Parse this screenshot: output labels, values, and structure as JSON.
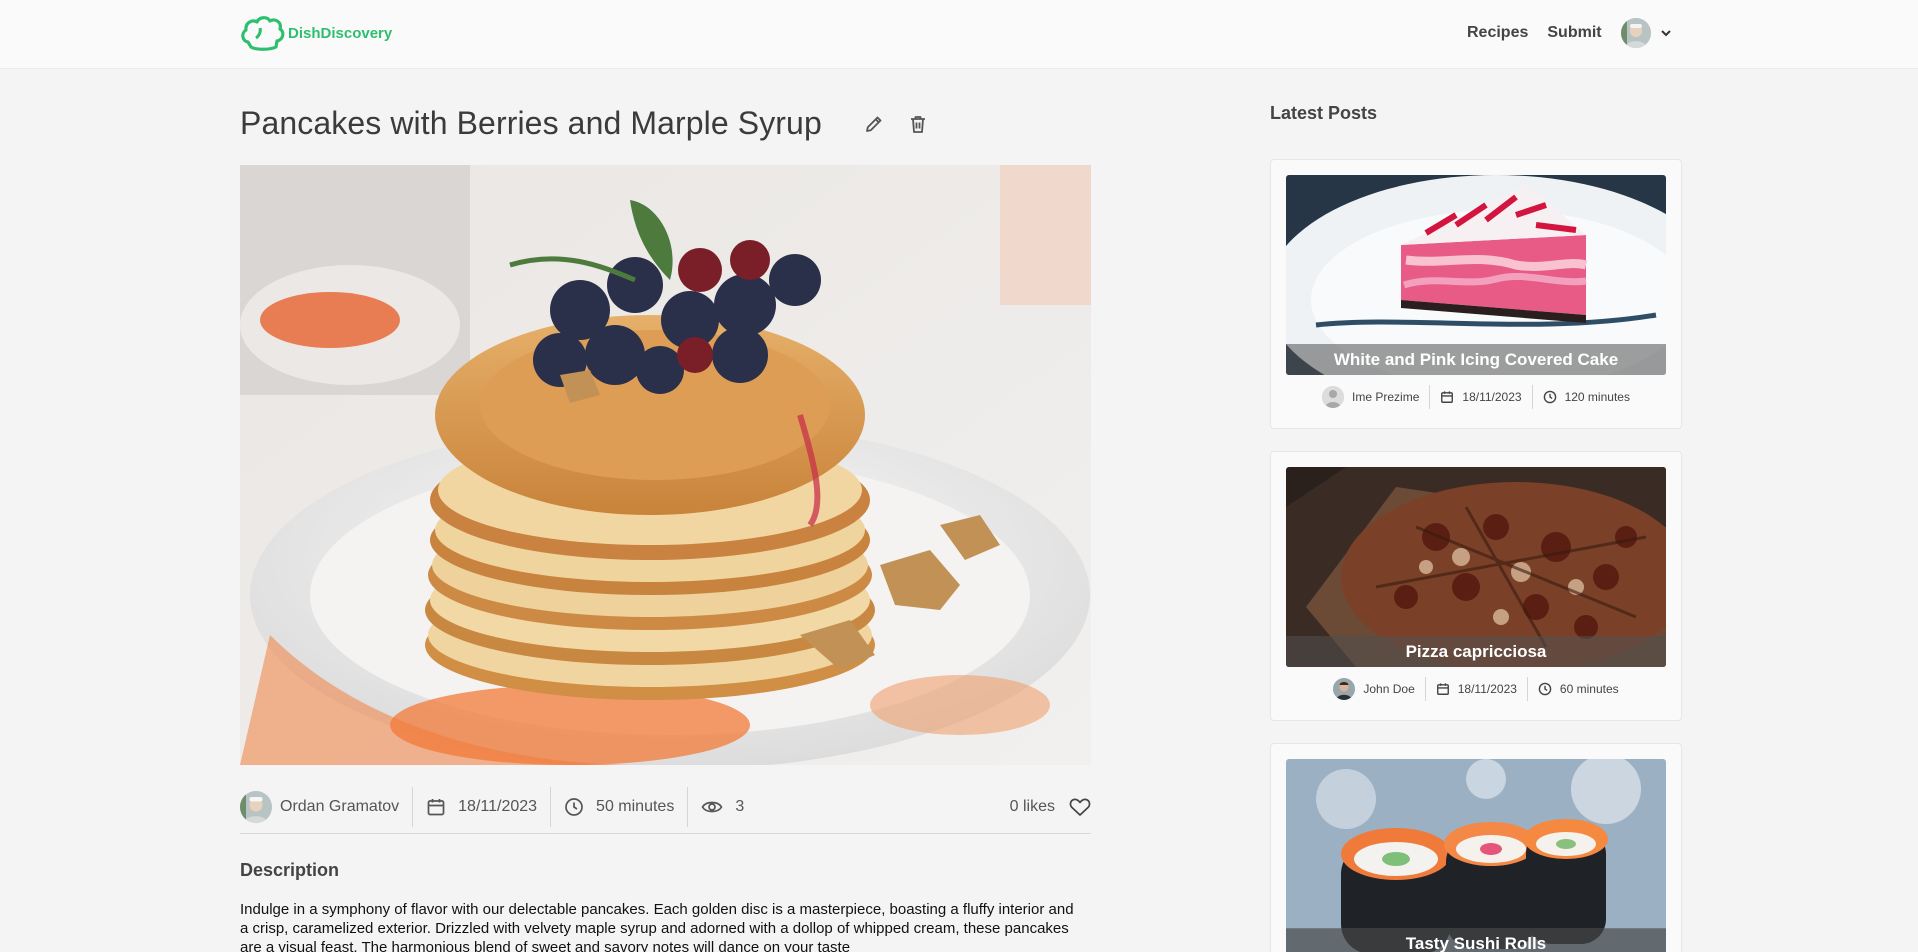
{
  "header": {
    "logo_text": "DishDiscovery",
    "nav": {
      "recipes": "Recipes",
      "submit": "Submit"
    },
    "brand_color": "#2ebf6e"
  },
  "post": {
    "title": "Pancakes with Berries and Marple Syrup",
    "author": "Ordan Gramatov",
    "date": "18/11/2023",
    "duration": "50 minutes",
    "views": "3",
    "likes": "0 likes",
    "description_heading": "Description",
    "description": "Indulge in a symphony of flavor with our delectable pancakes. Each golden disc is a masterpiece, boasting a fluffy interior and a crisp, caramelized exterior. Drizzled with velvety maple syrup and adorned with a dollop of whipped cream, these pancakes are a visual feast. The harmonious blend of sweet and savory notes will dance on your taste"
  },
  "sidebar": {
    "heading": "Latest Posts",
    "posts": [
      {
        "title": "White and Pink Icing Covered Cake",
        "author": "Ime Prezime",
        "date": "18/11/2023",
        "duration": "120 minutes"
      },
      {
        "title": "Pizza capricciosa",
        "author": "John Doe",
        "date": "18/11/2023",
        "duration": "60 minutes"
      },
      {
        "title": "Tasty Sushi Rolls"
      }
    ]
  },
  "icons": {
    "logo": "chef-hat-logo-icon",
    "edit": "pencil-icon",
    "delete": "trash-icon",
    "date": "calendar-icon",
    "duration": "clock-icon",
    "views": "eye-icon",
    "like": "heart-icon",
    "menu": "chevron-down-icon"
  }
}
